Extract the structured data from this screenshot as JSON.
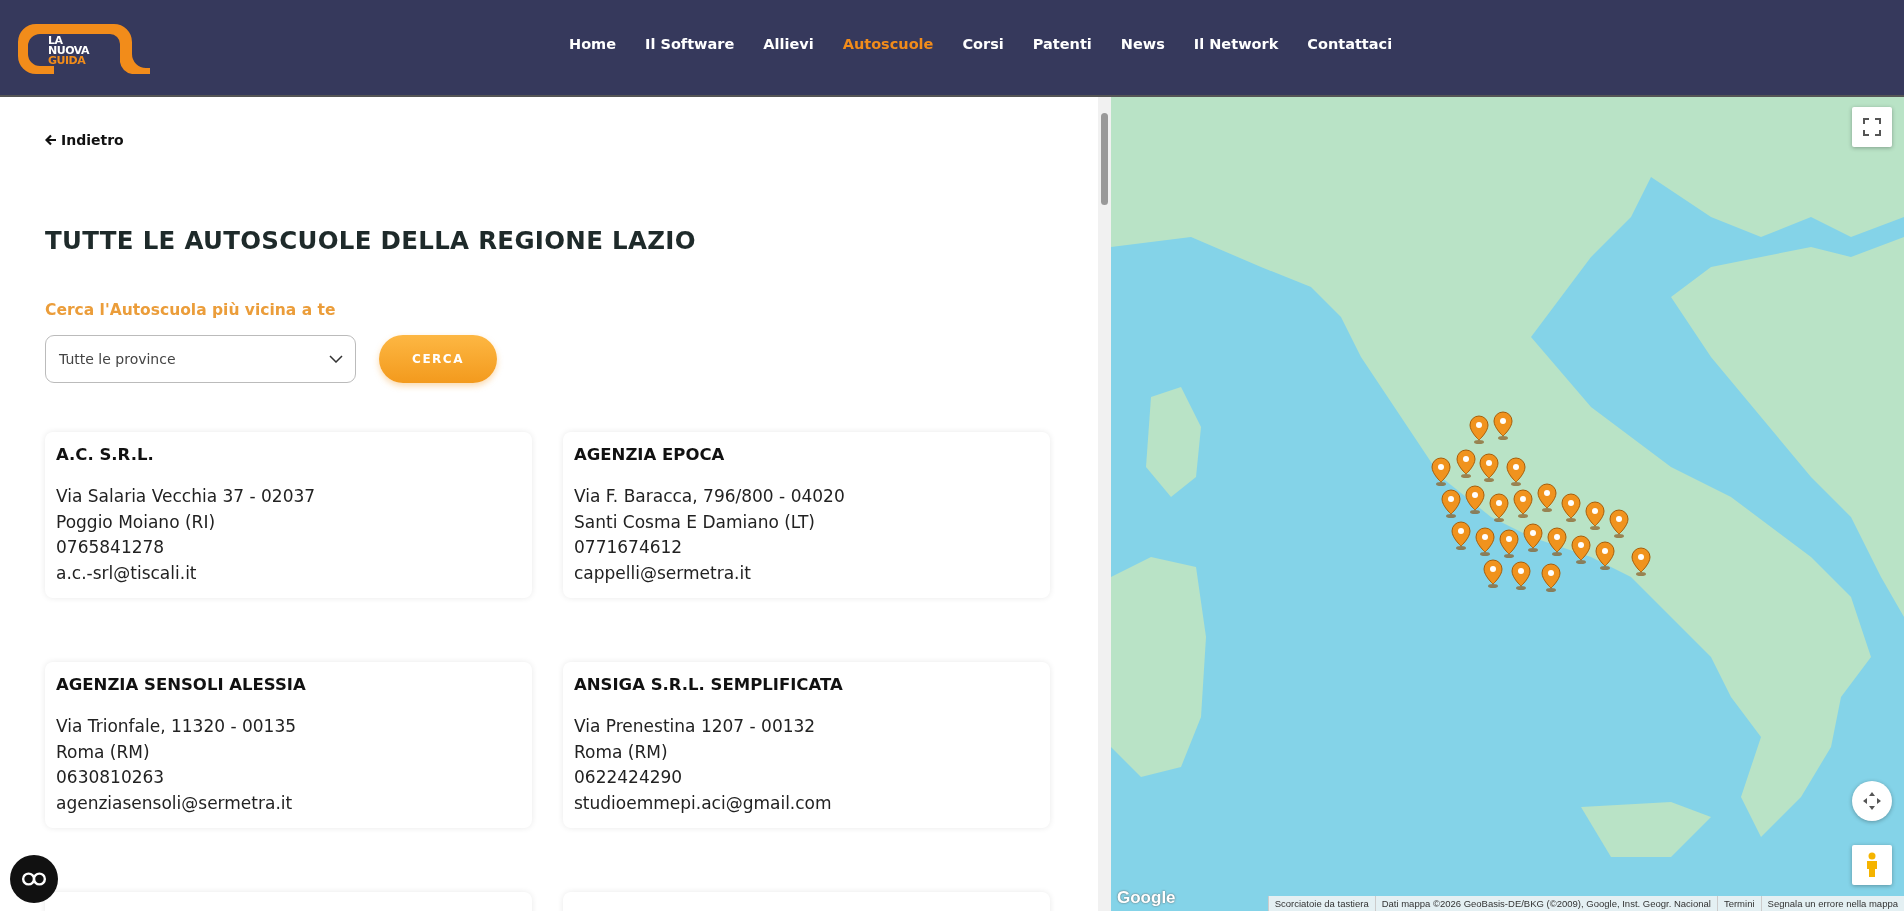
{
  "header": {
    "logo": [
      "LA",
      "NUOVA",
      "GUIDA"
    ],
    "nav": [
      {
        "label": "Home",
        "selected": false
      },
      {
        "label": "Il Software",
        "selected": false
      },
      {
        "label": "Allievi",
        "selected": false
      },
      {
        "label": "Autoscuole",
        "selected": true
      },
      {
        "label": "Corsi",
        "selected": false
      },
      {
        "label": "Patenti",
        "selected": false
      },
      {
        "label": "News",
        "selected": false
      },
      {
        "label": "Il Network",
        "selected": false
      },
      {
        "label": "Contattaci",
        "selected": false
      }
    ]
  },
  "back_link": "Indietro",
  "title": "TUTTE LE AUTOSCUOLE DELLA REGIONE LAZIO",
  "search": {
    "label": "Cerca l'Autoscuola più vicina a te",
    "province_select": "Tutte le province",
    "button": "CERCA"
  },
  "schools": [
    {
      "name": "A.C. S.R.L.",
      "address": "Via Salaria Vecchia 37 - 02037",
      "city": "Poggio Moiano (RI)",
      "phone": "0765841278",
      "email": "a.c.-srl@tiscali.it"
    },
    {
      "name": "AGENZIA EPOCA",
      "address": "Via F. Baracca, 796/800 - 04020",
      "city": "Santi Cosma E Damiano (LT)",
      "phone": "0771674612",
      "email": "cappelli@sermetra.it"
    },
    {
      "name": "AGENZIA SENSOLI ALESSIA",
      "address": "Via Trionfale, 11320 - 00135",
      "city": "Roma (RM)",
      "phone": "0630810263",
      "email": "agenziasensoli@sermetra.it"
    },
    {
      "name": "ANSIGA S.R.L. SEMPLIFICATA",
      "address": "Via Prenestina 1207 - 00132",
      "city": "Roma (RM)",
      "phone": "0622424290",
      "email": "studioemmepi.aci@gmail.com"
    }
  ],
  "map": {
    "logo": "Google",
    "footer": [
      "Scorciatoie da tastiera",
      "Dati mappa ©2026 GeoBasis-DE/BKG (©2009), Google, Inst. Geogr. Nacional",
      "Termini",
      "Segnala un errore nella mappa"
    ]
  }
}
